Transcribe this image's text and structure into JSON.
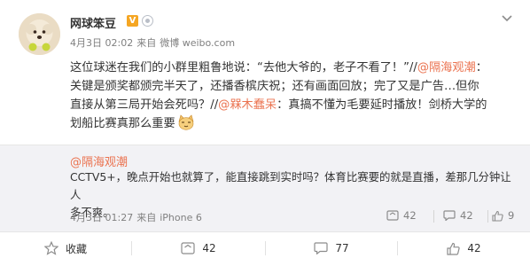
{
  "post": {
    "user_name": "网球笨豆",
    "verified_mark": "V",
    "meta": {
      "date": "4月3日 02:02",
      "source_prefix": "来自",
      "source": "微博 weibo.com"
    },
    "body": {
      "line1_text": "这位球迷在我们的小群里粗鲁地说：“去他大爷的，老子不看了！”//",
      "line1_mention": "@隔海观潮",
      "line1_colon": "：",
      "line2": "关键是颁奖都颁完半天了，还播香槟庆祝；还有画面回放；完了又是广告…但你",
      "line3_text": "直接从第三局开始会死吗？//",
      "line3_mention": "@槑木蠢呆",
      "line3_rest": "：真搞不懂为毛要延时播放！剑桥大学的",
      "line4_text": "划船比赛真那么重要"
    }
  },
  "quoted": {
    "user": "@隔海观潮",
    "line1": "CCTV5+，晚点开始也就算了，能直接跳到实时吗？体育比赛要的就是直播，差那几分钟让人",
    "line2": "多不爽。",
    "meta": {
      "date": "4月3日 01:27",
      "source_prefix": "来自",
      "source": "iPhone 6"
    },
    "actions": {
      "repost_count": "42",
      "comment_count": "42",
      "like_count": "9"
    }
  },
  "actions": {
    "favorite": "收藏",
    "repost": "42",
    "comment": "77",
    "like": "42"
  },
  "colors": {
    "mention": "#eb7350",
    "verified": "#f5a623",
    "like": "#eb7350"
  }
}
